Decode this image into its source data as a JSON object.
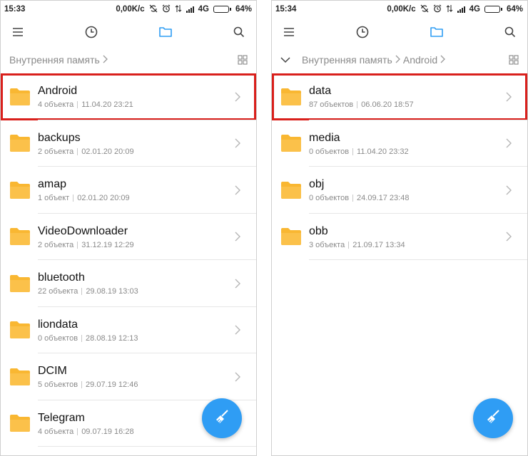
{
  "colors": {
    "accent": "#2f9df4",
    "folder": "#f9b732",
    "highlight": "#d9201c"
  },
  "left": {
    "status": {
      "time": "15:33",
      "speed": "0,00K/c",
      "network": "4G",
      "battery": "64%",
      "battery_level": 0.64
    },
    "toolbar": {
      "icons": [
        "menu-icon",
        "history-icon",
        "folder-icon",
        "search-icon"
      ]
    },
    "path": {
      "crumbs": [
        "Внутренняя память"
      ]
    },
    "items": [
      {
        "name": "Android",
        "count": "4 объекта",
        "date": "11.04.20 23:21"
      },
      {
        "name": "backups",
        "count": "2 объекта",
        "date": "02.01.20 20:09"
      },
      {
        "name": "amap",
        "count": "1 объект",
        "date": "02.01.20 20:09"
      },
      {
        "name": "VideoDownloader",
        "count": "2 объекта",
        "date": "31.12.19 12:29"
      },
      {
        "name": "bluetooth",
        "count": "22 объекта",
        "date": "29.08.19 13:03"
      },
      {
        "name": "liondata",
        "count": "0 объектов",
        "date": "28.08.19 12:13"
      },
      {
        "name": "DCIM",
        "count": "5 объектов",
        "date": "29.07.19 12:46"
      },
      {
        "name": "Telegram",
        "count": "4 объекта",
        "date": "09.07.19 16:28"
      }
    ]
  },
  "right": {
    "status": {
      "time": "15:34",
      "speed": "0,00K/c",
      "network": "4G",
      "battery": "64%",
      "battery_level": 0.64
    },
    "toolbar": {
      "icons": [
        "menu-icon",
        "history-icon",
        "folder-icon",
        "search-icon"
      ]
    },
    "path": {
      "crumbs": [
        "Внутренняя память",
        "Android"
      ]
    },
    "items": [
      {
        "name": "data",
        "count": "87 объектов",
        "date": "06.06.20 18:57"
      },
      {
        "name": "media",
        "count": "0 объектов",
        "date": "11.04.20 23:32"
      },
      {
        "name": "obj",
        "count": "0 объектов",
        "date": "24.09.17 23:48"
      },
      {
        "name": "obb",
        "count": "3 объекта",
        "date": "21.09.17 13:34"
      }
    ]
  }
}
